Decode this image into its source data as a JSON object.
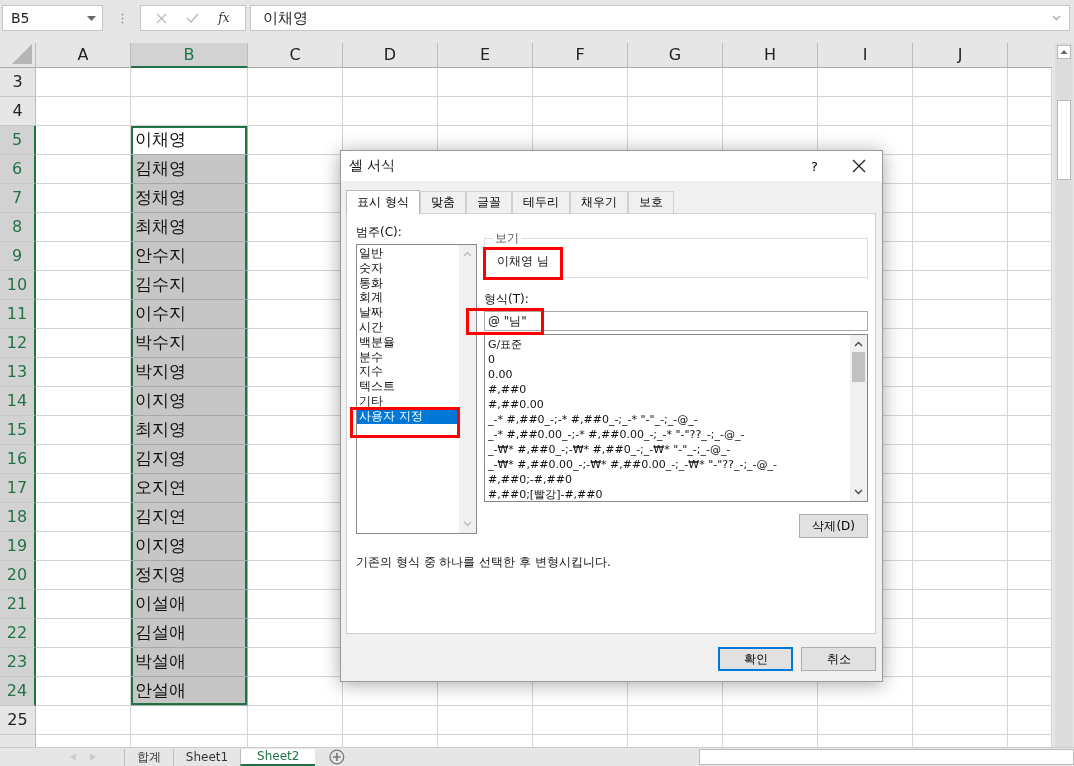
{
  "formula_bar": {
    "name_box": "B5",
    "function_label": "fx",
    "value": "이채영"
  },
  "columns": [
    {
      "letter": "A",
      "selected": false
    },
    {
      "letter": "B",
      "selected": true
    },
    {
      "letter": "C",
      "selected": false
    },
    {
      "letter": "D",
      "selected": false
    },
    {
      "letter": "E",
      "selected": false
    },
    {
      "letter": "F",
      "selected": false
    },
    {
      "letter": "G",
      "selected": false
    },
    {
      "letter": "H",
      "selected": false
    },
    {
      "letter": "I",
      "selected": false
    },
    {
      "letter": "J",
      "selected": false
    }
  ],
  "rows": [
    {
      "number": "3",
      "selected": false
    },
    {
      "number": "4",
      "selected": false
    },
    {
      "number": "5",
      "selected": true,
      "name_cell": {
        "value": "이채영",
        "selected": true,
        "active": true
      }
    },
    {
      "number": "6",
      "selected": true,
      "name_cell": {
        "value": "김채영",
        "selected": true,
        "active": false
      }
    },
    {
      "number": "7",
      "selected": true,
      "name_cell": {
        "value": "정채영",
        "selected": true,
        "active": false
      }
    },
    {
      "number": "8",
      "selected": true,
      "name_cell": {
        "value": "최채영",
        "selected": true,
        "active": false
      }
    },
    {
      "number": "9",
      "selected": true,
      "name_cell": {
        "value": "안수지",
        "selected": true,
        "active": false
      }
    },
    {
      "number": "10",
      "selected": true,
      "name_cell": {
        "value": "김수지",
        "selected": true,
        "active": false
      }
    },
    {
      "number": "11",
      "selected": true,
      "name_cell": {
        "value": "이수지",
        "selected": true,
        "active": false
      }
    },
    {
      "number": "12",
      "selected": true,
      "name_cell": {
        "value": "박수지",
        "selected": true,
        "active": false
      }
    },
    {
      "number": "13",
      "selected": true,
      "name_cell": {
        "value": "박지영",
        "selected": true,
        "active": false
      }
    },
    {
      "number": "14",
      "selected": true,
      "name_cell": {
        "value": "이지영",
        "selected": true,
        "active": false
      }
    },
    {
      "number": "15",
      "selected": true,
      "name_cell": {
        "value": "최지영",
        "selected": true,
        "active": false
      }
    },
    {
      "number": "16",
      "selected": true,
      "name_cell": {
        "value": "김지영",
        "selected": true,
        "active": false
      }
    },
    {
      "number": "17",
      "selected": true,
      "name_cell": {
        "value": "오지연",
        "selected": true,
        "active": false
      }
    },
    {
      "number": "18",
      "selected": true,
      "name_cell": {
        "value": "김지연",
        "selected": true,
        "active": false
      }
    },
    {
      "number": "19",
      "selected": true,
      "name_cell": {
        "value": "이지영",
        "selected": true,
        "active": false
      }
    },
    {
      "number": "20",
      "selected": true,
      "name_cell": {
        "value": "정지영",
        "selected": true,
        "active": false
      }
    },
    {
      "number": "21",
      "selected": true,
      "name_cell": {
        "value": "이설애",
        "selected": true,
        "active": false
      }
    },
    {
      "number": "22",
      "selected": true,
      "name_cell": {
        "value": "김설애",
        "selected": true,
        "active": false
      }
    },
    {
      "number": "23",
      "selected": true,
      "name_cell": {
        "value": "박설애",
        "selected": true,
        "active": false
      }
    },
    {
      "number": "24",
      "selected": true,
      "name_cell": {
        "value": "안설애",
        "selected": true,
        "active": false
      }
    },
    {
      "number": "25",
      "selected": false
    }
  ],
  "sheet_tabs": [
    {
      "label": "합계",
      "selected": false
    },
    {
      "label": "Sheet1",
      "selected": false
    },
    {
      "label": "Sheet2",
      "selected": true
    }
  ],
  "dialog": {
    "title": "셀 서식",
    "help": "?",
    "tabs": [
      {
        "label": "표시 형식",
        "selected": true
      },
      {
        "label": "맞춤",
        "selected": false
      },
      {
        "label": "글꼴",
        "selected": false
      },
      {
        "label": "테두리",
        "selected": false
      },
      {
        "label": "채우기",
        "selected": false
      },
      {
        "label": "보호",
        "selected": false
      }
    ],
    "category_label": "범주(C):",
    "categories": [
      {
        "label": "일반",
        "selected": false,
        "highlighted": false
      },
      {
        "label": "숫자",
        "selected": false,
        "highlighted": false
      },
      {
        "label": "통화",
        "selected": false,
        "highlighted": false
      },
      {
        "label": "회계",
        "selected": false,
        "highlighted": false
      },
      {
        "label": "날짜",
        "selected": false,
        "highlighted": false
      },
      {
        "label": "시간",
        "selected": false,
        "highlighted": false
      },
      {
        "label": "백분율",
        "selected": false,
        "highlighted": false
      },
      {
        "label": "분수",
        "selected": false,
        "highlighted": false
      },
      {
        "label": "지수",
        "selected": false,
        "highlighted": false
      },
      {
        "label": "텍스트",
        "selected": false,
        "highlighted": false
      },
      {
        "label": "기타",
        "selected": false,
        "highlighted": false
      },
      {
        "label": "사용자 지정",
        "selected": true,
        "highlighted": true
      }
    ],
    "preview": {
      "label": "보기",
      "value": "이채영 님",
      "highlighted": true
    },
    "format": {
      "label": "형식(T):",
      "value": "@ \"님\"",
      "highlighted": true
    },
    "format_list": [
      "G/표준",
      "0",
      "0.00",
      "#,##0",
      "#,##0.00",
      "_-* #,##0_-;-* #,##0_-;_-* \"-\"_-;_-@_-",
      "_-* #,##0.00_-;-* #,##0.00_-;_-* \"-\"??_-;_-@_-",
      "_-₩* #,##0_-;-₩* #,##0_-;_-₩* \"-\"_-;_-@_-",
      "_-₩* #,##0.00_-;-₩* #,##0.00_-;_-₩* \"-\"??_-;_-@_-",
      "#,##0;-#,##0",
      "#,##0;[빨강]-#,##0"
    ],
    "delete_button": "삭제(D)",
    "description": "기존의 형식 중 하나를 선택한 후 변형시킵니다.",
    "buttons": [
      {
        "label": "확인",
        "default": true
      },
      {
        "label": "취소",
        "default": false
      }
    ]
  }
}
